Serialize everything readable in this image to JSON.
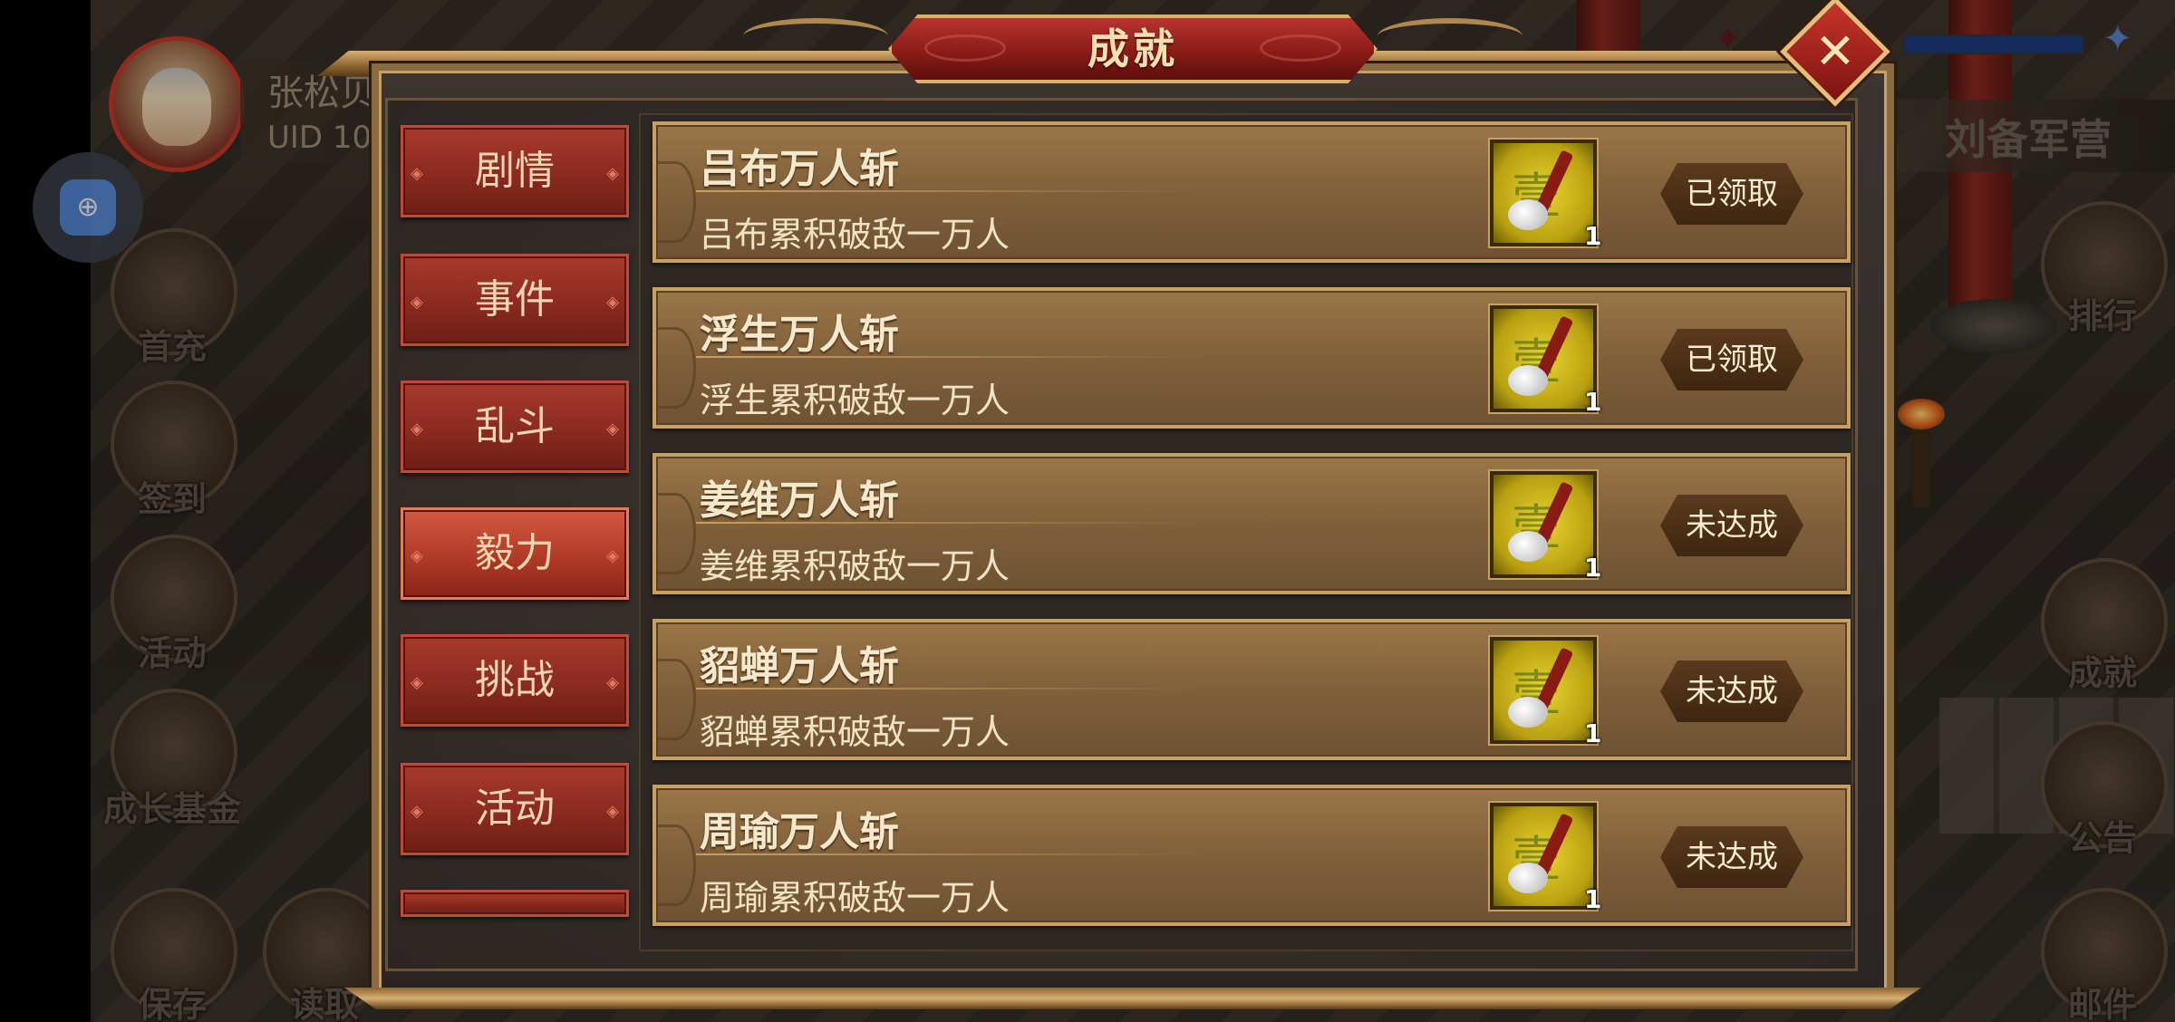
{
  "hud": {
    "player_name": "张松贝",
    "uid_text": "UID 10",
    "camp_title": "刘备军营",
    "left_buttons": [
      {
        "label": "首充",
        "icon": "gift-bag-icon"
      },
      {
        "label": "签到",
        "icon": "scroll-brush-icon"
      },
      {
        "label": "活动",
        "icon": "treasure-icon"
      },
      {
        "label": "成长基金",
        "icon": "flower-icon"
      },
      {
        "label": "保存",
        "icon": "save-icon"
      },
      {
        "label": "读取",
        "icon": "load-icon"
      }
    ],
    "right_buttons": [
      {
        "label": "排行",
        "icon": "ranking-board-icon"
      },
      {
        "label": "成就",
        "icon": "achievement-chest-icon"
      },
      {
        "label": "公告",
        "icon": "notice-scroll-icon"
      },
      {
        "label": "邮件",
        "icon": "mail-icon"
      }
    ]
  },
  "dialog": {
    "title": "成就",
    "close_icon": "close-icon",
    "close_glyph": "✕",
    "tabs": [
      {
        "label": "剧情",
        "active": false
      },
      {
        "label": "事件",
        "active": false
      },
      {
        "label": "乱斗",
        "active": false
      },
      {
        "label": "毅力",
        "active": true
      },
      {
        "label": "挑战",
        "active": false
      },
      {
        "label": "活动",
        "active": false
      }
    ],
    "achievements": [
      {
        "title": "吕布万人斩",
        "description": "吕布累积破敌一万人",
        "reward_count": "1",
        "status": "已领取"
      },
      {
        "title": "浮生万人斩",
        "description": "浮生累积破敌一万人",
        "reward_count": "1",
        "status": "已领取"
      },
      {
        "title": "姜维万人斩",
        "description": "姜维累积破敌一万人",
        "reward_count": "1",
        "status": "未达成"
      },
      {
        "title": "貂蝉万人斩",
        "description": "貂蝉累积破敌一万人",
        "reward_count": "1",
        "status": "未达成"
      },
      {
        "title": "周瑜万人斩",
        "description": "周瑜累积破敌一万人",
        "reward_count": "1",
        "status": "未达成"
      }
    ],
    "reward_icon": "brush-token-icon"
  },
  "colors": {
    "tab_red": "#a83a2c",
    "row_gold": "#9a7748",
    "frame_gold": "#c8a060",
    "title_red": "#8a1c18"
  }
}
